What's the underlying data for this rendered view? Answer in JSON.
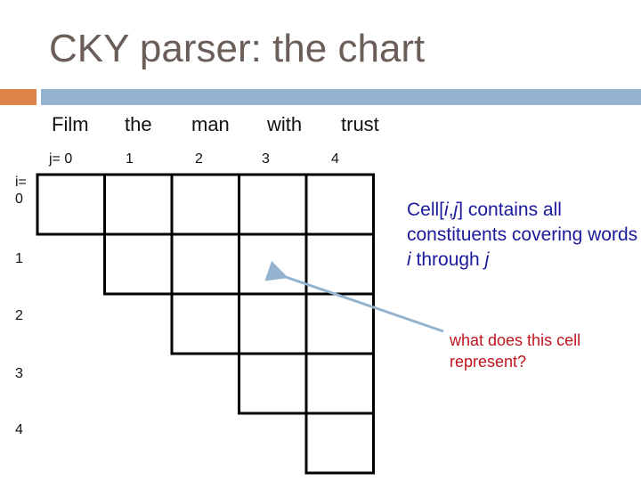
{
  "slide": {
    "title": "CKY parser: the chart",
    "accent_colors": {
      "orange": "#e0834a",
      "blue": "#94b3cf"
    }
  },
  "sentence": {
    "words": [
      "Film",
      "the",
      "man",
      "with",
      "trust"
    ],
    "j_labels": [
      "j= 0",
      "1",
      "2",
      "3",
      "4"
    ],
    "i_labels": [
      "i=\n0",
      "1",
      "2",
      "3",
      "4"
    ]
  },
  "chart": {
    "size": 5,
    "shape": "upper-triangular",
    "highlighted_cell": {
      "i": 1,
      "j": 3
    }
  },
  "annotations": {
    "definition": {
      "prefix": "Cell[",
      "i": "i",
      "comma": ",",
      "j": "j",
      "suffix": "] contains all constituents covering words ",
      "i2": "i",
      "through": " through ",
      "j2": "j",
      "color": "#1a1a9c"
    },
    "question": {
      "text": "what does this cell represent?",
      "color": "#c0141c"
    },
    "arrow_color": "#94b3cf"
  }
}
